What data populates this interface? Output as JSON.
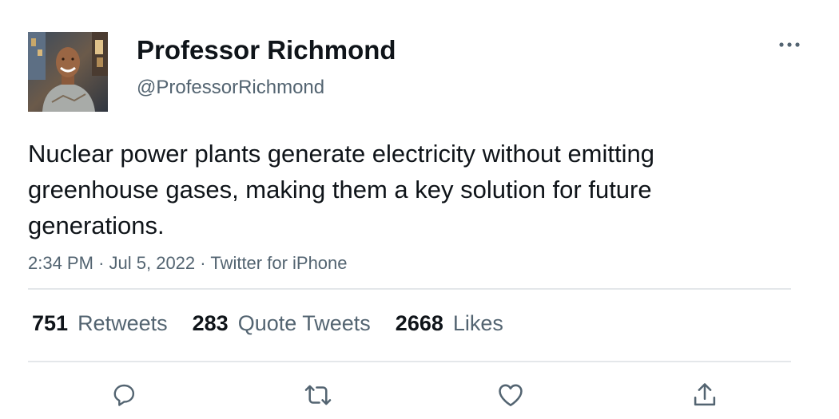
{
  "user": {
    "display_name": "Professor Richmond",
    "handle": "@ProfessorRichmond"
  },
  "tweet": {
    "text": "Nuclear power plants generate electricity without emitting greenhouse gases, making them a key solution for future generations.",
    "time": "2:34 PM",
    "date": "Jul 5, 2022",
    "source": "Twitter for iPhone",
    "separator": "·"
  },
  "stats": [
    {
      "count": "751",
      "label": "Retweets"
    },
    {
      "count": "283",
      "label": "Quote Tweets"
    },
    {
      "count": "2668",
      "label": "Likes"
    }
  ],
  "actions": {
    "reply_icon": "reply-icon",
    "retweet_icon": "retweet-icon",
    "like_icon": "heart-icon",
    "share_icon": "share-icon"
  },
  "more_icon": "more-icon",
  "colors": {
    "text_primary": "#0f1419",
    "text_secondary": "#536471",
    "divider": "#e4e7ea"
  }
}
